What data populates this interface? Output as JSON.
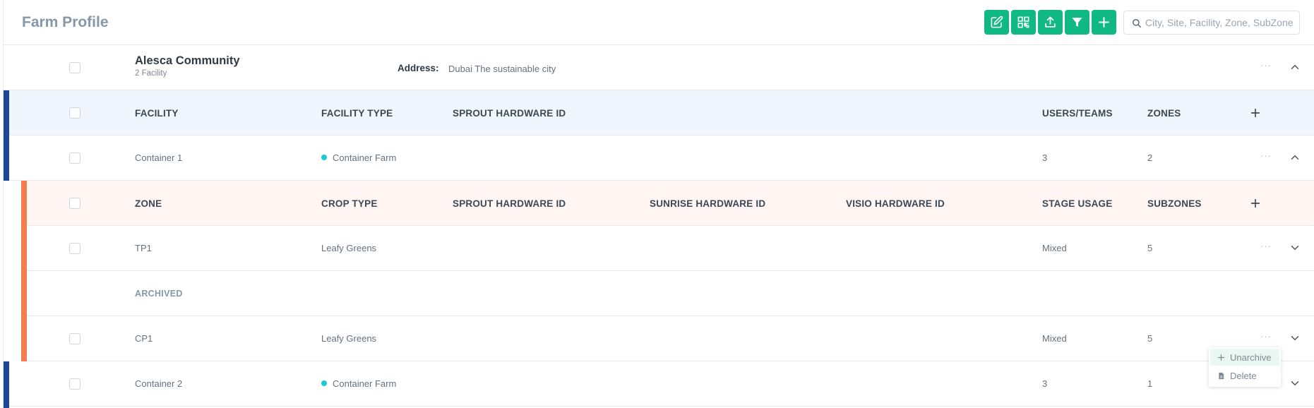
{
  "header": {
    "title": "Farm Profile",
    "toolbar": [
      "edit-icon",
      "qr-code-icon",
      "upload-icon",
      "filter-icon",
      "plus-icon"
    ],
    "search_placeholder": "City, Site, Facility, Zone, SubZone"
  },
  "colors": {
    "accent": "#10b982",
    "facility_bar": "#1e4799",
    "zone_bar": "#f47d4f",
    "facility_type_dot": "#1ac8d6"
  },
  "community": {
    "name": "Alesca Community",
    "facility_count": "2 Facility",
    "address_label": "Address:",
    "address": "Dubai The sustainable city",
    "more": "···"
  },
  "facility_table": {
    "headers": {
      "facility": "FACILITY",
      "type": "FACILITY TYPE",
      "sprout": "SPROUT HARDWARE ID",
      "users": "USERS/TEAMS",
      "zones": "ZONES"
    },
    "rows": [
      {
        "name": "Container 1",
        "type": "Container Farm",
        "users": "3",
        "zones": "2",
        "more": "···"
      },
      {
        "name": "Container 2",
        "type": "Container Farm",
        "users": "3",
        "zones": "1",
        "more": "···"
      }
    ]
  },
  "zone_table": {
    "headers": {
      "zone": "ZONE",
      "crop": "CROP TYPE",
      "sprout": "SPROUT HARDWARE ID",
      "sunrise": "SUNRISE HARDWARE ID",
      "visio": "VISIO HARDWARE ID",
      "stage": "STAGE USAGE",
      "subzones": "SUBZONES"
    },
    "active": [
      {
        "zone": "TP1",
        "crop": "Leafy Greens",
        "stage": "Mixed",
        "subzones": "5",
        "more": "···"
      }
    ],
    "archived_label": "ARCHIVED",
    "archived": [
      {
        "zone": "CP1",
        "crop": "Leafy Greens",
        "stage": "Mixed",
        "subzones": "5",
        "more": "···"
      }
    ]
  },
  "context_menu": {
    "unarchive": "Unarchive",
    "delete": "Delete"
  }
}
